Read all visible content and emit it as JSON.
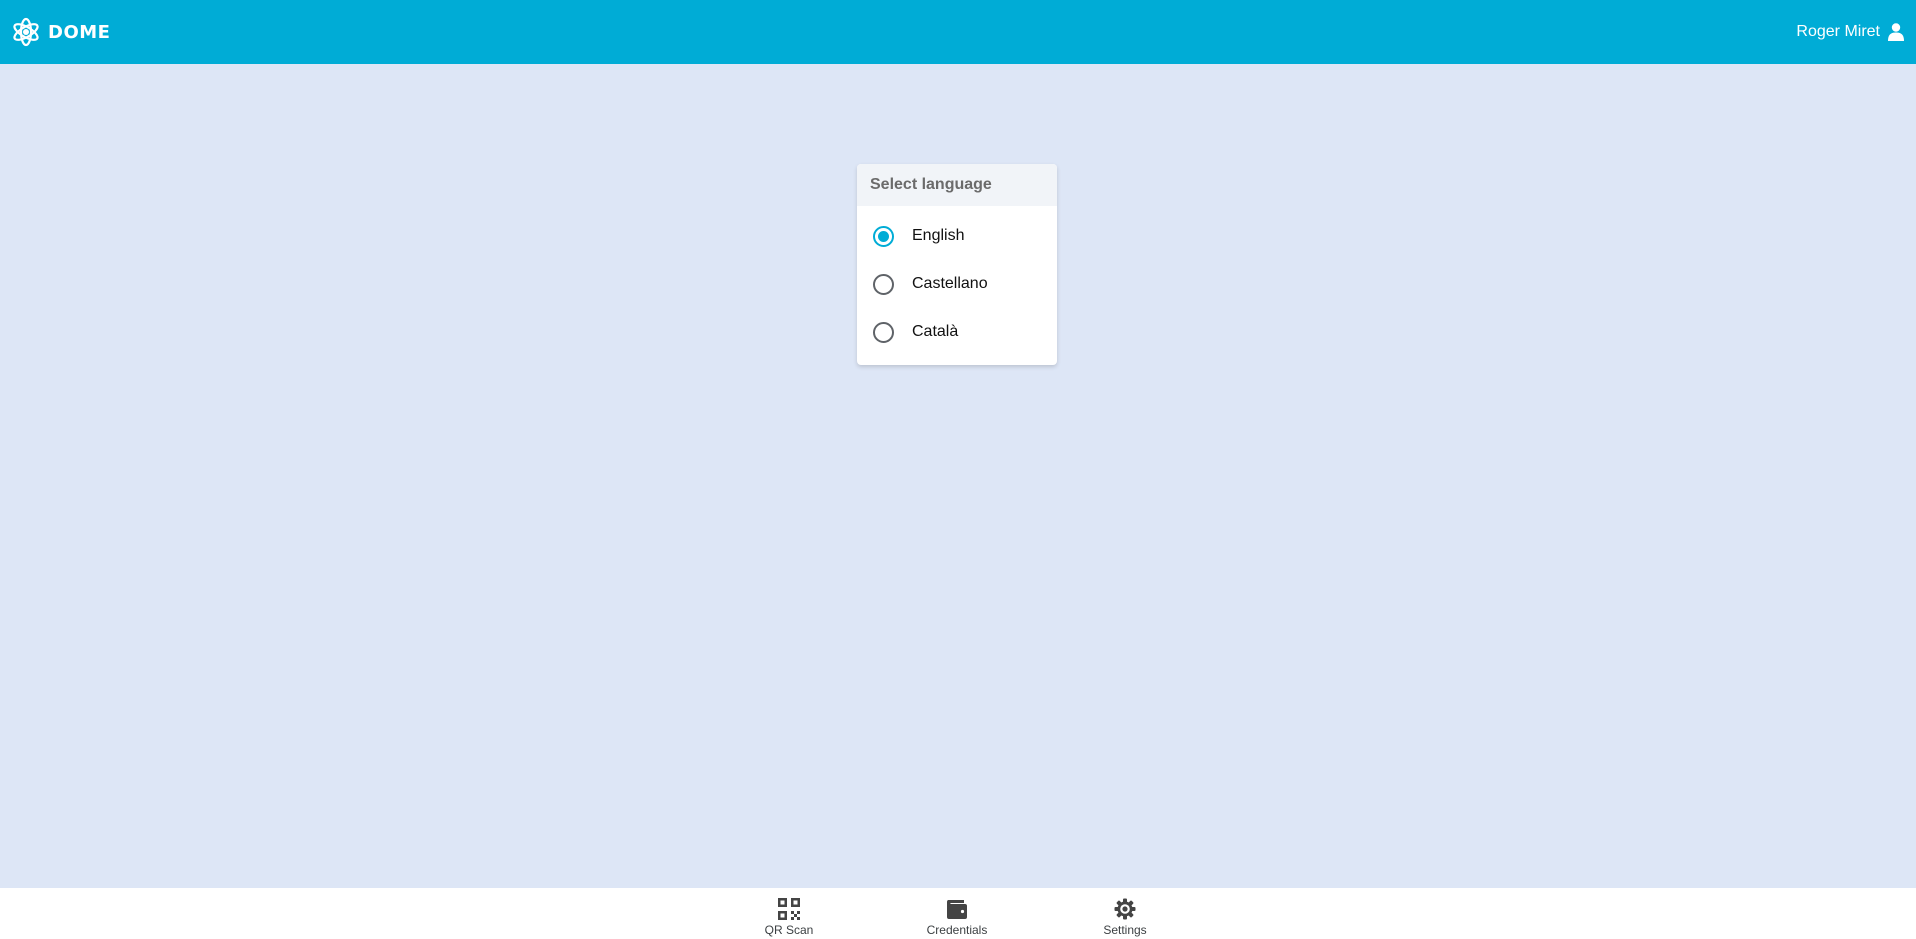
{
  "app": {
    "brand": "DOME"
  },
  "header": {
    "user_name": "Roger Miret"
  },
  "language_panel": {
    "title": "Select language",
    "options": [
      {
        "label": "English",
        "selected": true
      },
      {
        "label": "Castellano",
        "selected": false
      },
      {
        "label": "Català",
        "selected": false
      }
    ]
  },
  "bottom_nav": {
    "items": [
      {
        "label": "QR Scan",
        "icon": "qr-code-icon"
      },
      {
        "label": "Credentials",
        "icon": "wallet-icon"
      },
      {
        "label": "Settings",
        "icon": "gear-icon"
      }
    ]
  },
  "colors": {
    "accent": "#00acd6",
    "background": "#dde6f6",
    "panel_header": "#f1f4f8"
  }
}
